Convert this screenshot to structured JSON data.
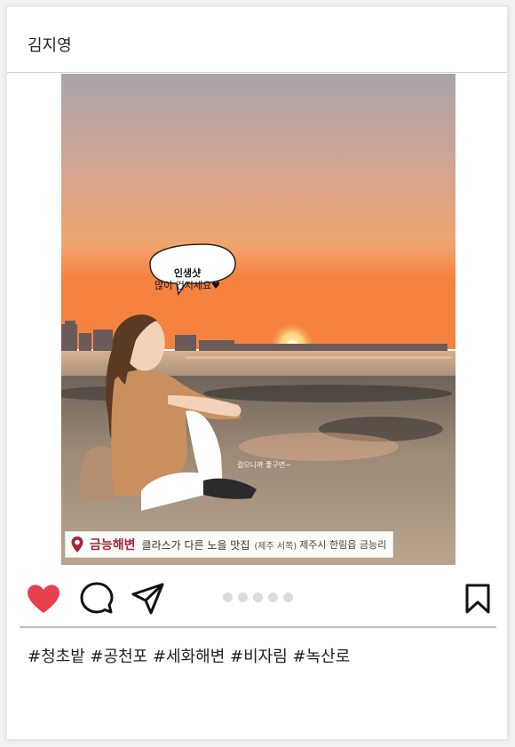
{
  "post": {
    "username": "김지영",
    "photo": {
      "speech_line1": "인생샷",
      "speech_line2": "많이 건지세요♥",
      "credit": "걸으니까 좋구먼~",
      "place_name": "금능해변",
      "place_desc": "클라스가 다른 노을 맛집",
      "place_region": "(제주 서쪽)",
      "place_address": "제주시 한림읍 금능리"
    },
    "actions": {
      "like_icon": "heart-icon",
      "comment_icon": "comment-icon",
      "share_icon": "send-icon",
      "save_icon": "bookmark-icon",
      "liked": true,
      "carousel_dots": 5
    },
    "hashtags": "#청초밭 #공천포 #세화해변 #비자림 #녹산로"
  },
  "colors": {
    "heart": "#e8404c",
    "place_name": "#a3273c",
    "sky_top": "#a9a3a8",
    "sky_bottom": "#f2894a"
  }
}
